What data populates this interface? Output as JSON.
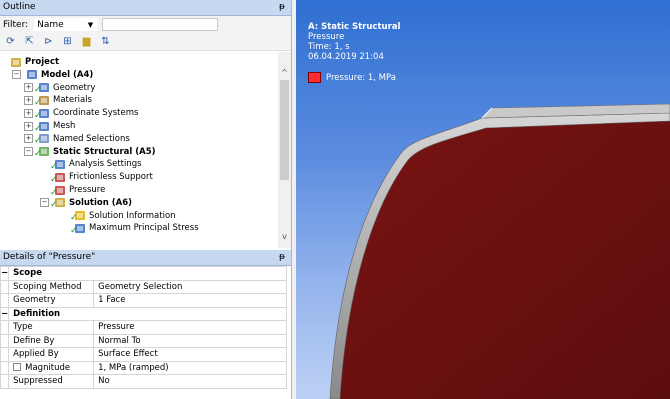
{
  "outline": {
    "title": "Outline",
    "filter_label": "Filter:",
    "filter_value": "Name",
    "tree": [
      {
        "label": "Project",
        "level": 0,
        "bold": true,
        "icon": "project-icon"
      },
      {
        "label": "Model (A4)",
        "level": 1,
        "bold": true,
        "icon": "model-icon",
        "expander": "−"
      },
      {
        "label": "Geometry",
        "level": 2,
        "icon": "geometry-icon",
        "expander": "+"
      },
      {
        "label": "Materials",
        "level": 2,
        "icon": "materials-icon",
        "expander": "+"
      },
      {
        "label": "Coordinate Systems",
        "level": 2,
        "icon": "coordinate-systems-icon",
        "expander": "+"
      },
      {
        "label": "Mesh",
        "level": 2,
        "icon": "mesh-icon",
        "expander": "+"
      },
      {
        "label": "Named Selections",
        "level": 2,
        "icon": "named-selections-icon",
        "expander": "+"
      },
      {
        "label": "Static Structural (A5)",
        "level": 2,
        "bold": true,
        "icon": "static-structural-icon",
        "expander": "−"
      },
      {
        "label": "Analysis Settings",
        "level": 3,
        "icon": "analysis-settings-icon"
      },
      {
        "label": "Frictionless Support",
        "level": 3,
        "icon": "frictionless-support-icon"
      },
      {
        "label": "Pressure",
        "level": 3,
        "icon": "pressure-icon"
      },
      {
        "label": "Solution (A6)",
        "level": 3,
        "bold": true,
        "icon": "solution-icon",
        "expander": "−"
      },
      {
        "label": "Solution Information",
        "level": 4,
        "icon": "solution-information-icon"
      },
      {
        "label": "Maximum Principal Stress",
        "level": 4,
        "icon": "maximum-principal-stress-icon"
      }
    ]
  },
  "details": {
    "title": "Details of \"Pressure\"",
    "sections": [
      {
        "name": "Scope",
        "rows": [
          {
            "key": "Scoping Method",
            "value": "Geometry Selection"
          },
          {
            "key": "Geometry",
            "value": "1 Face"
          }
        ]
      },
      {
        "name": "Definition",
        "rows": [
          {
            "key": "Type",
            "value": "Pressure"
          },
          {
            "key": "Define By",
            "value": "Normal To"
          },
          {
            "key": "Applied By",
            "value": "Surface Effect"
          },
          {
            "key": "Magnitude",
            "value": "1, MPa  (ramped)",
            "checkbox": true
          },
          {
            "key": "Suppressed",
            "value": "No"
          }
        ]
      }
    ]
  },
  "viewport": {
    "legend_title": "A: Static Structural",
    "legend_lines": [
      "Pressure",
      "Time: 1, s",
      "06.04.2019 21:04"
    ],
    "legend_item": "Pressure: 1, MPa",
    "legend_color": "#ff2d2d"
  }
}
